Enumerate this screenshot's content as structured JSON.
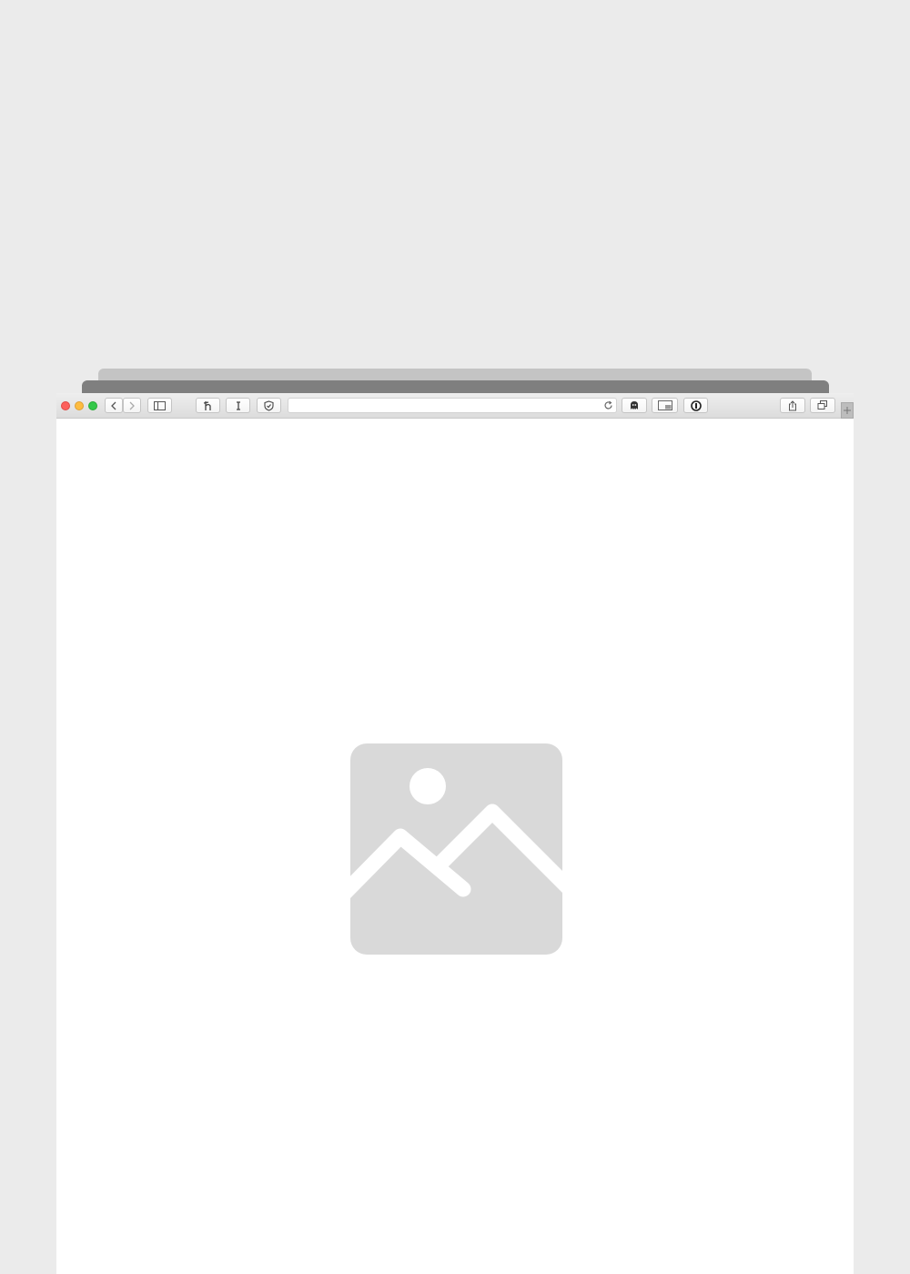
{
  "browser": {
    "window_controls": [
      "close",
      "minimize",
      "zoom"
    ],
    "nav_buttons": [
      "chevron-left-icon",
      "chevron-right-icon"
    ],
    "sidebar_button": "sidebar-icon",
    "extension_buttons": [
      "honey-icon",
      "text-cursor-icon",
      "shield-check-icon"
    ],
    "address_bar": {
      "value": "",
      "reload_icon": "reload-icon"
    },
    "right_extensions": [
      "ghostery-icon",
      "picture-in-picture-icon",
      "password-manager-icon"
    ],
    "actions": [
      "share-icon",
      "tabs-overview-icon"
    ],
    "new_tab_icon": "plus-icon"
  },
  "content": {
    "image_placeholder": {
      "icon": "image-placeholder-icon",
      "color": "#d9d9d9"
    }
  },
  "colors": {
    "background": "#ebebeb",
    "page": "#ffffff",
    "close": "#fc605c",
    "minimize": "#fdbc40",
    "zoom": "#34c84a"
  }
}
